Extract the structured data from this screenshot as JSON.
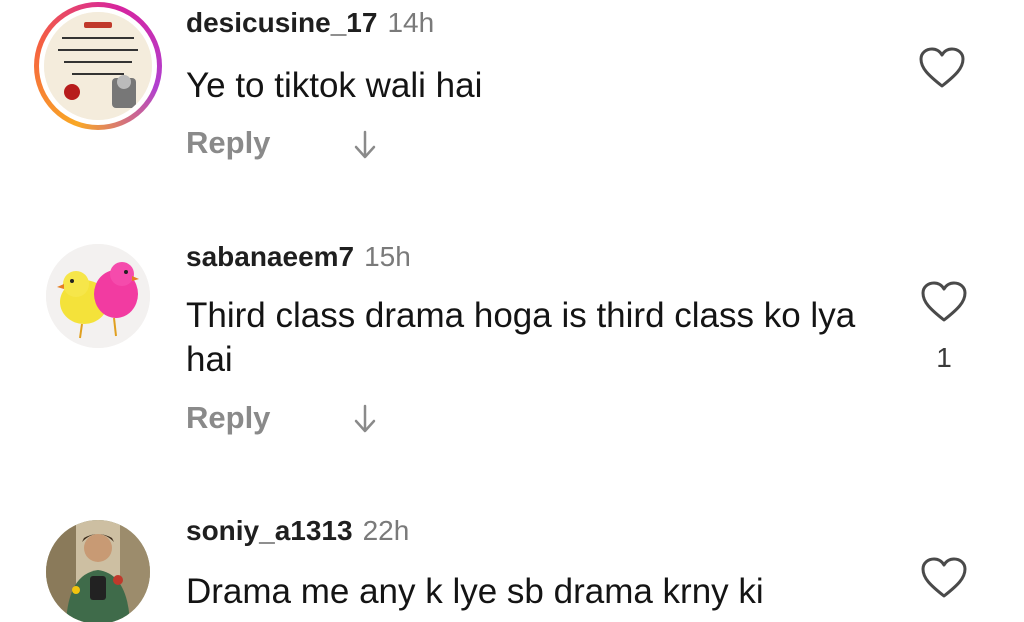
{
  "comments": [
    {
      "username": "desicusine_17",
      "time": "14h",
      "text": "Ye to tiktok wali hai",
      "reply_label": "Reply",
      "like_count": "",
      "avatar_icon": "urdu-quote-avatar",
      "has_story_ring": true,
      "avatar_text": "زندگی کی مسافت روز مرتا کروں"
    },
    {
      "username": "sabanaeem7",
      "time": "15h",
      "text": "Third class drama hoga is third class ko lya hai",
      "reply_label": "Reply",
      "like_count": "1",
      "avatar_icon": "chicks-avatar",
      "has_story_ring": false
    },
    {
      "username": "soniy_a1313",
      "time": "22h",
      "text": "Drama me any k lye sb drama krny ki",
      "reply_label": "",
      "like_count": "",
      "avatar_icon": "person-avatar",
      "has_story_ring": false
    }
  ],
  "colors": {
    "username": "#1f1f1f",
    "time": "#7a7a7a",
    "reply": "#8a8a8a",
    "story_ring_start": "#f9a825",
    "story_ring_end": "#d6249f"
  }
}
